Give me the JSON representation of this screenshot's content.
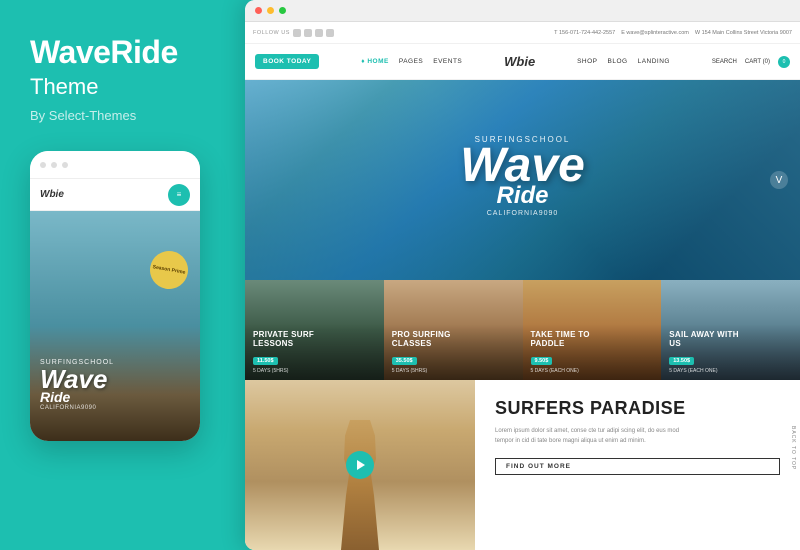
{
  "left_panel": {
    "brand_name": "WaveRide",
    "brand_subtitle": "Theme",
    "brand_author": "By Select-Themes",
    "mobile_logo": "Wbie",
    "mobile_surfing_label": "SURFINGSCHOOL",
    "mobile_wave": "Wave",
    "mobile_ride": "Ride",
    "mobile_ca": "CALIFORNIA9090",
    "season_badge": "Season\nPrime"
  },
  "browser": {
    "dots": [
      "red",
      "yellow",
      "green"
    ]
  },
  "site": {
    "top_bar": {
      "follow_label": "FOLLOW US",
      "phone": "T 156-071-724-442-2557",
      "email": "E wave@splinteractive.com",
      "address": "W 154 Main Collins Street Victoria 9007"
    },
    "nav": {
      "book_button": "BOOK TODAY",
      "links": [
        "♦ HOME",
        "PAGES",
        "EVENTS"
      ],
      "logo": "Wbie",
      "right_links": [
        "SHOP",
        "BLOG",
        "LANDING"
      ],
      "search": "SEARCH",
      "cart": "CART (0)",
      "cart_count": "0"
    },
    "hero": {
      "surf_school": "SURFINGSCHOOL",
      "wave_text": "Wave",
      "ride_text": "Ride",
      "california": "CALIFORNIA9090"
    },
    "cards": [
      {
        "title": "PRIVATE SURF\nLESSONS",
        "price": "11.50$",
        "days": "5 DAYS (5HRS)"
      },
      {
        "title": "PRO SURFING\nCLASSES",
        "price": "35.50$",
        "days": "5 DAYS (5HRS)"
      },
      {
        "title": "TAKE TIME TO\nPADDLE",
        "price": "9.50$",
        "days": "5 DAYS (EACH ONE)"
      },
      {
        "title": "SAIL AWAY WITH\nUS",
        "price": "13.50$",
        "days": "5 DAYS (EACH ONE)"
      }
    ],
    "bottom": {
      "section_title": "SURFERS PARADISE",
      "body_text": "Lorem ipsum dolor sit amet, conse cte tur adipi scing elit, do eus mod tempor in cid di tate bore magni aliqua ut enim ad minim.",
      "find_out_button": "FIND OUT MORE"
    },
    "back_to_top": "BACK TO TOP"
  }
}
